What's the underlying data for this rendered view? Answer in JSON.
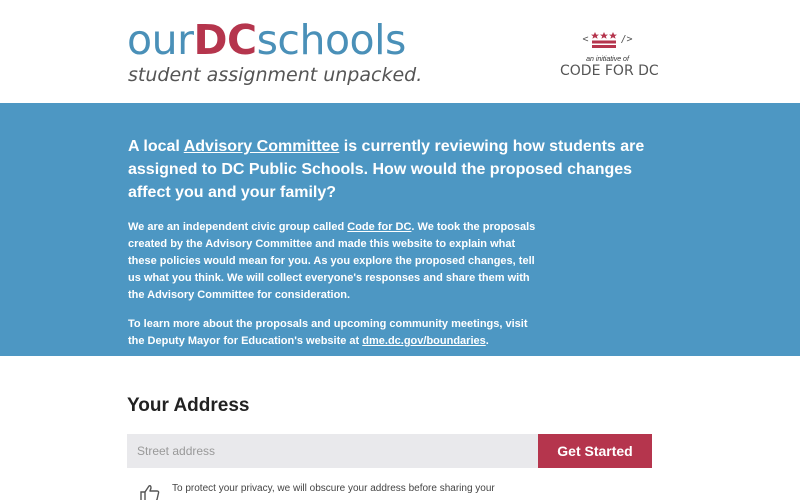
{
  "header": {
    "logo_prefix": "our",
    "logo_dc": "DC",
    "logo_suffix": "schools",
    "tagline": "student assignment unpacked.",
    "initiative_small": "an initiative of",
    "initiative_name": "CODE FOR DC",
    "brand_blue": "#4a90b8",
    "brand_red": "#b5354d"
  },
  "hero": {
    "bg_color": "#4d97c3",
    "h1_before": "A local ",
    "h1_link": "Advisory Committee",
    "h1_after": " is currently reviewing how students are assigned to DC Public Schools. How would the proposed changes affect you and your family?",
    "p1_before": "We are an independent civic group called ",
    "p1_link": "Code for DC",
    "p1_after": ". We took the proposals created by the Advisory Committee and made this website to explain what these policies would mean for you. As you explore the proposed changes, tell us what you think. We will collect everyone's responses and share them with the Advisory Committee for consideration.",
    "p2_before": "To learn more about the proposals and upcoming community meetings, visit the Deputy Mayor for Education's website at ",
    "p2_link": "dme.dc.gov/boundaries",
    "p2_after": "."
  },
  "address": {
    "title": "Your Address",
    "placeholder": "Street address",
    "value": "",
    "button_label": "Get Started",
    "privacy_text": "To protect your privacy, we will obscure your address before sharing your"
  }
}
